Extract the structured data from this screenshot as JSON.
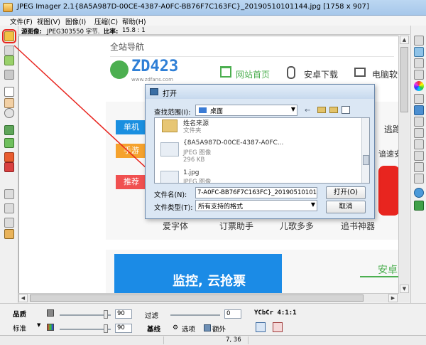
{
  "window": {
    "title": "JPEG Imager 2.1{8A5A987D-00CE-4387-A0FC-BB76F7C163FC}_20190510101144.jpg [1758 x 907]"
  },
  "menu": [
    "文件(F)",
    "视图(V)",
    "图像(I)",
    "压缩(C)",
    "帮助(H)"
  ],
  "info": {
    "label": "源图像:",
    "size_text": "JPEG303550 字节.",
    "ratio_label": "比率:",
    "ratio_value": "15.8 : 1"
  },
  "site": {
    "nav_title": "全站导航",
    "logo_text": "ZD423",
    "logo_url": "www.zdfans.com",
    "nav_links": [
      "网站首页",
      "安卓下载",
      "电脑软件"
    ],
    "category_buttons": [
      "单机",
      "手游",
      "推荐"
    ],
    "right_snippets": [
      "逃跑",
      "谙速安卓"
    ],
    "app_names": [
      "爱字体",
      "订票助手",
      "儿歌多多",
      "追书神器"
    ],
    "banner_text": "监控, 云抢票",
    "side_tab": "安卓游"
  },
  "dialog": {
    "title": "打开",
    "look_in_label": "查找范围(I):",
    "look_in_value": "桌面",
    "files": [
      {
        "name": "姓名来源",
        "type": "文件夹",
        "size": ""
      },
      {
        "name": "{8A5A987D-00CE-4387-A0FC...",
        "type": "JPEG 图像",
        "size": "296 KB"
      },
      {
        "name": "1.jpg",
        "type": "JPEG 图像",
        "size": ""
      }
    ],
    "filename_label": "文件名(N):",
    "filename_value": "7-A0FC-BB76F7C163FC}_20190510101144.jpg",
    "filetype_label": "文件类型(T):",
    "filetype_value": "所有支持的格式",
    "open_button": "打开(O)",
    "cancel_button": "取消"
  },
  "bottom": {
    "quality_label": "品质",
    "standard_label": "标准",
    "quality_value": "90",
    "standard_value": "90",
    "filter_label": "过滤",
    "filter_value": "0",
    "baseline_label": "基线",
    "options_label": "选项",
    "extra_label": "额外",
    "color_mode": "YCbCr 4:1:1"
  },
  "status": {
    "coords": "7, 36"
  },
  "colors": {
    "accent_red": "#e8251f",
    "btn_blue": "#1a8fe0",
    "btn_orange": "#f5a22d",
    "btn_red": "#f05050",
    "logo_green": "#4caf50",
    "logo_blue": "#2f7fd6"
  }
}
